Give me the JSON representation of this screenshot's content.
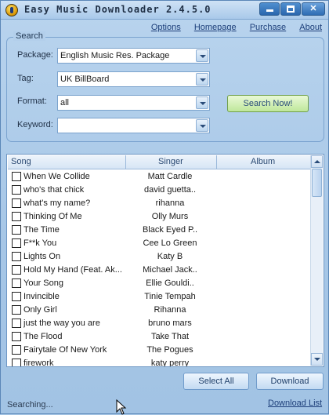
{
  "window": {
    "title": "Easy Music Downloader 2.4.5.0"
  },
  "links": [
    "Options",
    "Homepage",
    "Purchase",
    "About"
  ],
  "search": {
    "group_title": "Search",
    "package_label": "Package:",
    "package_value": "English Music Res. Package",
    "tag_label": "Tag:",
    "tag_value": "UK BillBoard",
    "format_label": "Format:",
    "format_value": "all",
    "keyword_label": "Keyword:",
    "keyword_value": "",
    "search_button": "Search Now!"
  },
  "list": {
    "columns": {
      "song": "Song",
      "singer": "Singer",
      "album": "Album"
    },
    "rows": [
      {
        "song": "When We Collide",
        "singer": "Matt Cardle"
      },
      {
        "song": "who's that chick",
        "singer": "david guetta.."
      },
      {
        "song": "what's my name?",
        "singer": "rihanna"
      },
      {
        "song": "Thinking Of Me",
        "singer": "Olly Murs"
      },
      {
        "song": "The Time",
        "singer": "Black Eyed P.."
      },
      {
        "song": "F**k You",
        "singer": "Cee Lo Green"
      },
      {
        "song": "Lights On",
        "singer": "Katy B"
      },
      {
        "song": "Hold My Hand (Feat. Ak...",
        "singer": "Michael Jack.."
      },
      {
        "song": "Your Song",
        "singer": "Ellie Gouldi.."
      },
      {
        "song": "Invincible",
        "singer": "Tinie Tempah"
      },
      {
        "song": "Only Girl",
        "singer": "Rihanna"
      },
      {
        "song": "just the way you are",
        "singer": "bruno mars"
      },
      {
        "song": "The Flood",
        "singer": "Take That"
      },
      {
        "song": "Fairytale Of New York",
        "singer": "The Pogues"
      },
      {
        "song": "firework",
        "singer": "katy perry"
      }
    ]
  },
  "buttons": {
    "select_all": "Select All",
    "download": "Download"
  },
  "status": "Searching...",
  "download_list_link": "Download List"
}
